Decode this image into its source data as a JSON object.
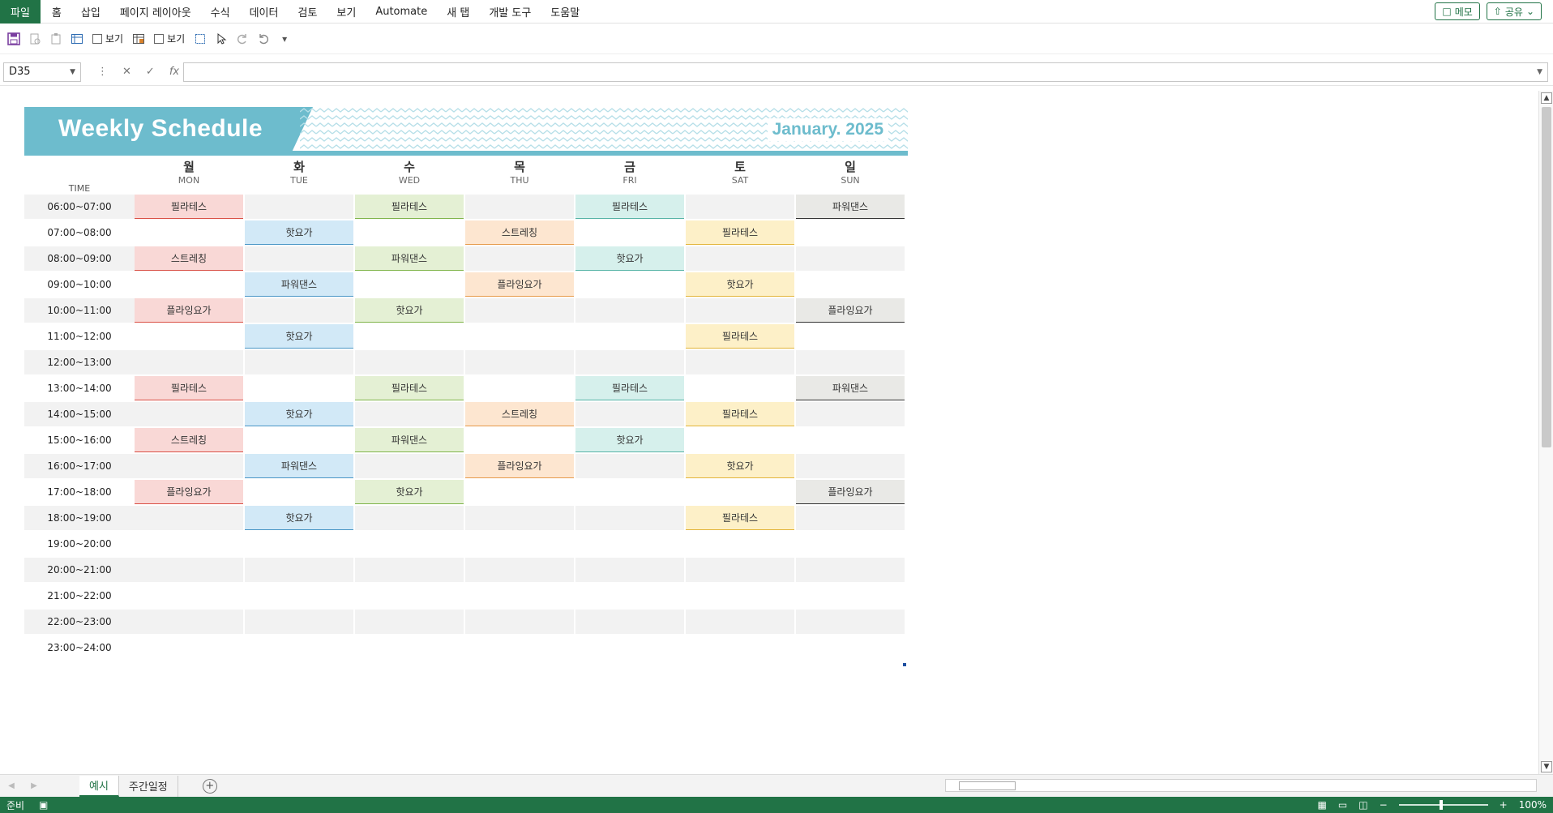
{
  "ribbon": {
    "tabs": [
      "파일",
      "홈",
      "삽입",
      "페이지 레이아웃",
      "수식",
      "데이터",
      "검토",
      "보기",
      "Automate",
      "새 탭",
      "개발 도구",
      "도움말"
    ],
    "memo": "메모",
    "share": "공유"
  },
  "toolbar": {
    "view_check1": "보기",
    "view_check2": "보기"
  },
  "formula": {
    "namebox": "D35",
    "fx": "fx",
    "value": ""
  },
  "schedule": {
    "title": "Weekly Schedule",
    "month": "January. 2025",
    "time_header": "TIME",
    "days": [
      {
        "kr": "월",
        "en": "MON"
      },
      {
        "kr": "화",
        "en": "TUE"
      },
      {
        "kr": "수",
        "en": "WED"
      },
      {
        "kr": "목",
        "en": "THU"
      },
      {
        "kr": "금",
        "en": "FRI"
      },
      {
        "kr": "토",
        "en": "SAT"
      },
      {
        "kr": "일",
        "en": "SUN"
      }
    ],
    "day_colors": [
      {
        "fill": "#f9d8d6",
        "line": "#d94f45"
      },
      {
        "fill": "#d2e9f7",
        "line": "#4a96c6"
      },
      {
        "fill": "#e4f0d4",
        "line": "#7fb44a"
      },
      {
        "fill": "#fde6d0",
        "line": "#e69a4a"
      },
      {
        "fill": "#d6f0ec",
        "line": "#55b3a6"
      },
      {
        "fill": "#fdf0c8",
        "line": "#e3b53a"
      },
      {
        "fill": "#e9e9e6",
        "line": "#333333"
      }
    ],
    "rows": [
      {
        "time": "06:00~07:00",
        "cells": [
          "필라테스",
          "",
          "필라테스",
          "",
          "필라테스",
          "",
          "파워댄스"
        ]
      },
      {
        "time": "07:00~08:00",
        "cells": [
          "",
          "핫요가",
          "",
          "스트레칭",
          "",
          "필라테스",
          ""
        ]
      },
      {
        "time": "08:00~09:00",
        "cells": [
          "스트레칭",
          "",
          "파워댄스",
          "",
          "핫요가",
          "",
          ""
        ]
      },
      {
        "time": "09:00~10:00",
        "cells": [
          "",
          "파워댄스",
          "",
          "플라잉요가",
          "",
          "핫요가",
          ""
        ]
      },
      {
        "time": "10:00~11:00",
        "cells": [
          "플라잉요가",
          "",
          "핫요가",
          "",
          "",
          "",
          "플라잉요가"
        ]
      },
      {
        "time": "11:00~12:00",
        "cells": [
          "",
          "핫요가",
          "",
          "",
          "",
          "필라테스",
          ""
        ]
      },
      {
        "time": "12:00~13:00",
        "cells": [
          "",
          "",
          "",
          "",
          "",
          "",
          ""
        ]
      },
      {
        "time": "13:00~14:00",
        "cells": [
          "필라테스",
          "",
          "필라테스",
          "",
          "필라테스",
          "",
          "파워댄스"
        ]
      },
      {
        "time": "14:00~15:00",
        "cells": [
          "",
          "핫요가",
          "",
          "스트레칭",
          "",
          "필라테스",
          ""
        ]
      },
      {
        "time": "15:00~16:00",
        "cells": [
          "스트레칭",
          "",
          "파워댄스",
          "",
          "핫요가",
          "",
          ""
        ]
      },
      {
        "time": "16:00~17:00",
        "cells": [
          "",
          "파워댄스",
          "",
          "플라잉요가",
          "",
          "핫요가",
          ""
        ]
      },
      {
        "time": "17:00~18:00",
        "cells": [
          "플라잉요가",
          "",
          "핫요가",
          "",
          "",
          "",
          "플라잉요가"
        ]
      },
      {
        "time": "18:00~19:00",
        "cells": [
          "",
          "핫요가",
          "",
          "",
          "",
          "필라테스",
          ""
        ]
      },
      {
        "time": "19:00~20:00",
        "cells": [
          "",
          "",
          "",
          "",
          "",
          "",
          ""
        ]
      },
      {
        "time": "20:00~21:00",
        "cells": [
          "",
          "",
          "",
          "",
          "",
          "",
          ""
        ]
      },
      {
        "time": "21:00~22:00",
        "cells": [
          "",
          "",
          "",
          "",
          "",
          "",
          ""
        ]
      },
      {
        "time": "22:00~23:00",
        "cells": [
          "",
          "",
          "",
          "",
          "",
          "",
          ""
        ]
      },
      {
        "time": "23:00~24:00",
        "cells": [
          "",
          "",
          "",
          "",
          "",
          "",
          ""
        ]
      }
    ]
  },
  "sheets": {
    "tabs": [
      "예시",
      "주간일정"
    ],
    "active": 0
  },
  "status": {
    "ready": "준비",
    "zoom": "100%"
  },
  "colors": {
    "accent": "#217346",
    "banner": "#6dbccd"
  }
}
